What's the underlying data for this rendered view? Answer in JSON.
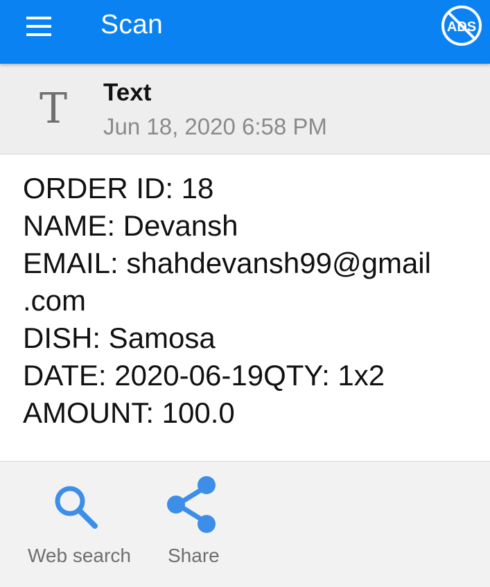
{
  "appbar": {
    "title": "Scan",
    "menu_icon": "menu-icon",
    "no_ads_icon": "no-ads-icon",
    "no_ads_text": "ADS",
    "color": "#0b82f2"
  },
  "scan_header": {
    "type_icon_glyph": "T",
    "type_label": "Text",
    "date": "Jun 18, 2020 6:58 PM"
  },
  "content": {
    "lines": [
      "ORDER ID: 18",
      "NAME: Devansh",
      "EMAIL: shahdevansh99@gmail",
      ".com",
      "DISH: Samosa",
      "DATE: 2020-06-19QTY: 1x2",
      "AMOUNT: 100.0"
    ]
  },
  "actions": [
    {
      "label": "Web search",
      "icon": "search-icon",
      "color": "#3d8ee8"
    },
    {
      "label": "Share",
      "icon": "share-icon",
      "color": "#3d8ee8"
    }
  ]
}
